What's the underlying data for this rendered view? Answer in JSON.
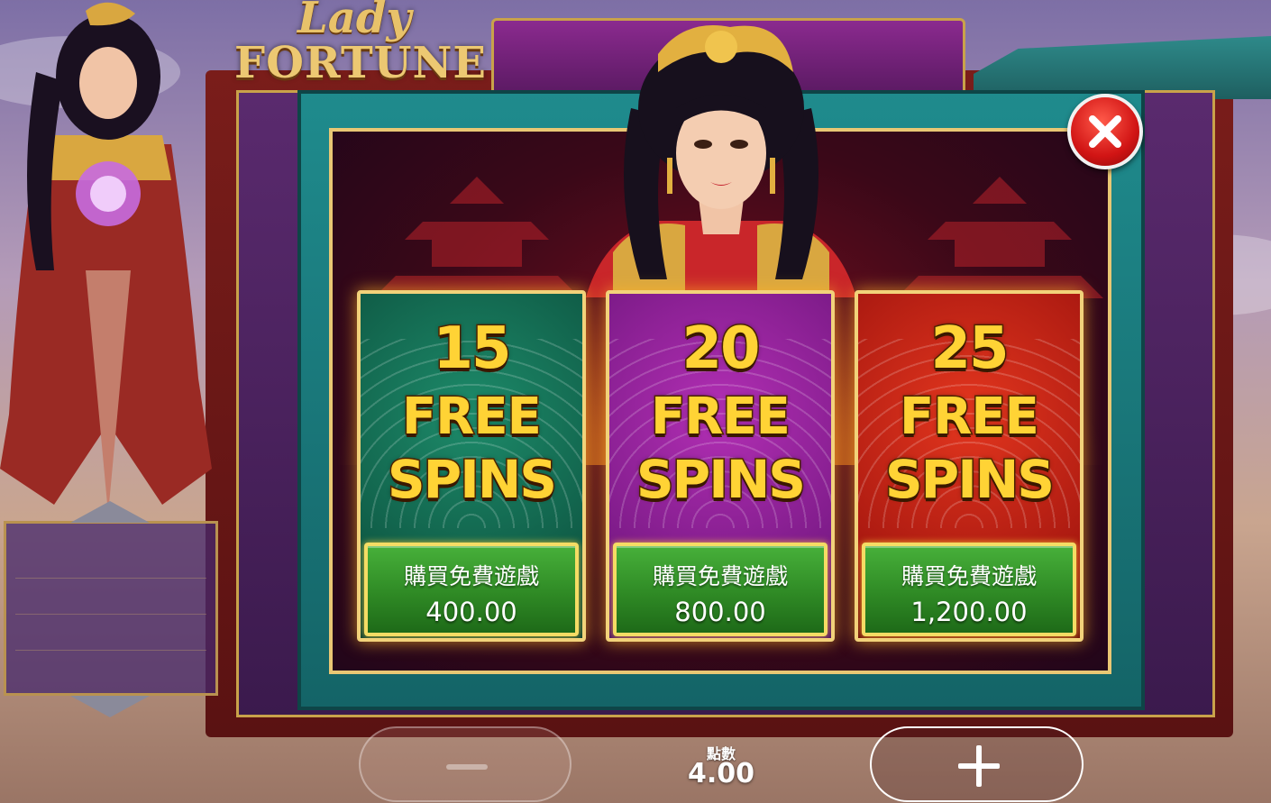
{
  "logo": {
    "line1": "Lady",
    "line2": "FORTUNE"
  },
  "offers": [
    {
      "count": "15",
      "free": "FREE",
      "spins": "SPINS",
      "buy_label": "購買免費遊戲",
      "price": "400.00",
      "theme": "green"
    },
    {
      "count": "20",
      "free": "FREE",
      "spins": "SPINS",
      "buy_label": "購買免費遊戲",
      "price": "800.00",
      "theme": "purple"
    },
    {
      "count": "25",
      "free": "FREE",
      "spins": "SPINS",
      "buy_label": "購買免費遊戲",
      "price": "1,200.00",
      "theme": "red"
    }
  ],
  "bet": {
    "label": "點數",
    "value": "4.00"
  },
  "icons": {
    "close": "close-icon",
    "minus": "minus-icon",
    "plus": "plus-icon"
  },
  "colors": {
    "frame_teal": "#1f8b8d",
    "gold": "#e9c774",
    "buy_green": "#2f8a25",
    "close_red": "#d11414"
  }
}
